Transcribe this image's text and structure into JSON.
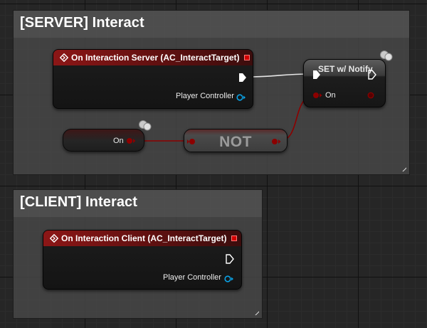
{
  "server_comment": {
    "title": "[SERVER] Interact"
  },
  "client_comment": {
    "title": "[CLIENT] Interact"
  },
  "server_event": {
    "title": "On Interaction Server (AC_InteractTarget)",
    "output_label": "Player Controller"
  },
  "client_event": {
    "title": "On Interaction Client (AC_InteractTarget)",
    "output_label": "Player Controller"
  },
  "get_on": {
    "label": "On"
  },
  "not_node": {
    "title": "NOT"
  },
  "set_node": {
    "title": "SET w/ Notify",
    "input_label": "On"
  },
  "colors": {
    "event_header": "#8c1616",
    "bool_pin": "#8c0000",
    "object_pin": "#0aa2e6",
    "exec_pin": "#ffffff"
  }
}
